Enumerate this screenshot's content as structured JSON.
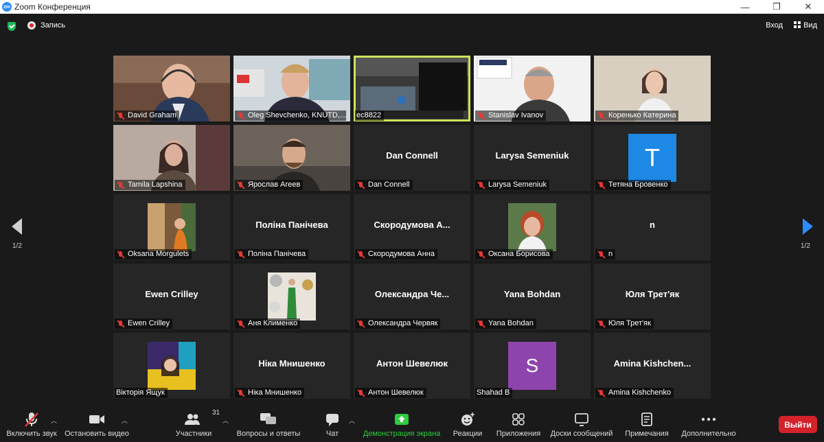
{
  "window": {
    "title": "Zoom Конференция",
    "app_badge": "zm",
    "min": "—",
    "max": "❐",
    "close": "✕"
  },
  "topbar": {
    "record_label": "Запись",
    "enter_label": "Вход",
    "view_label": "Вид"
  },
  "pager": {
    "left": "1/2",
    "right": "1/2"
  },
  "tiles": [
    {
      "label": "David Graham",
      "kind": "video"
    },
    {
      "label": "Oleg Shevchenko, KNUTD,...",
      "kind": "video"
    },
    {
      "label": "ec8822",
      "kind": "video",
      "active": true
    },
    {
      "label": "Stanislav Ivanov",
      "kind": "video"
    },
    {
      "label": "Коренько Катерина",
      "kind": "video"
    },
    {
      "label": "Tamila Lapshina",
      "kind": "video"
    },
    {
      "label": "Ярослав Агеев",
      "kind": "video"
    },
    {
      "label": "Dan Connell",
      "name": "Dan Connell",
      "kind": "name"
    },
    {
      "label": "Larysa Semeniuk",
      "name": "Larysa Semeniuk",
      "kind": "name"
    },
    {
      "label": "Тетяна Бровенко",
      "kind": "avatar",
      "letter": "T"
    },
    {
      "label": "Oksana Morgulets",
      "kind": "photo"
    },
    {
      "label": "Поліна Панічева",
      "name": "Поліна Панічева",
      "kind": "name"
    },
    {
      "label": "Скородумова Анна",
      "name": "Скородумова  А...",
      "kind": "name"
    },
    {
      "label": "Оксана Борисова",
      "kind": "photo"
    },
    {
      "label": "n",
      "name": "n",
      "kind": "name"
    },
    {
      "label": "Ewen Crilley",
      "name": "Ewen Crilley",
      "kind": "name"
    },
    {
      "label": "Аня Клименко",
      "kind": "photo"
    },
    {
      "label": "Олександра Червяк",
      "name": "Олександра  Че...",
      "kind": "name"
    },
    {
      "label": "Yana Bohdan",
      "name": "Yana Bohdan",
      "kind": "name"
    },
    {
      "label": "Юля Трет'як",
      "name": "Юля Трет'як",
      "kind": "name"
    },
    {
      "label": "Вікторія Ящук",
      "kind": "photo"
    },
    {
      "label": "Ніка Мнишенко",
      "name": "Ніка Мнишенко",
      "kind": "name"
    },
    {
      "label": "Антон Шевелюк",
      "name": "Антон Шевелюк",
      "kind": "name"
    },
    {
      "label": "Shahad B",
      "kind": "avatar",
      "letter": "S"
    },
    {
      "label": "Amina Kishchenko",
      "name": "Amina  Kishchen...",
      "kind": "name"
    }
  ],
  "toolbar": {
    "unmute": "Включить звук",
    "start_video": "Остановить видео",
    "participants": "Участники",
    "participants_count": "31",
    "qa": "Вопросы и ответы",
    "chat": "Чат",
    "share": "Демонстрация экрана",
    "reactions": "Реакции",
    "apps": "Приложения",
    "whiteboards": "Доски сообщений",
    "notes": "Примечания",
    "more": "Дополнительно",
    "leave": "Выйти"
  },
  "colors": {
    "accent": "#2d8cff",
    "share": "#2ecc40",
    "leave": "#d3222a",
    "active_border": "#cde35a"
  }
}
